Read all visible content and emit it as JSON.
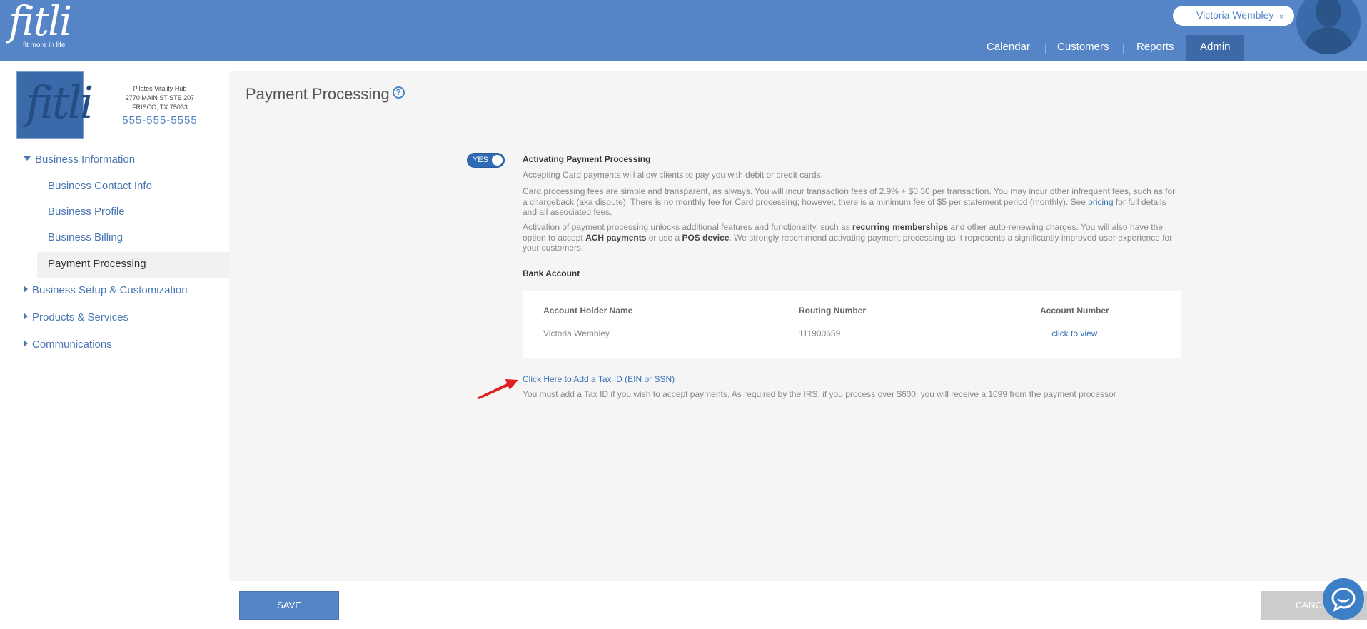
{
  "header": {
    "logo_text": "fitli",
    "logo_tagline": "fit more in life",
    "user_name": "Victoria Wembley",
    "user_chevron": "»",
    "nav": [
      {
        "label": "Calendar"
      },
      {
        "label": "Customers"
      },
      {
        "label": "Reports"
      },
      {
        "label": "Admin",
        "active": true
      }
    ]
  },
  "business": {
    "logo_text": "fitli",
    "name": "Pilates Vitality Hub",
    "address1": "2770 MAIN ST STE 207",
    "address2": "FRISCO, TX 75033",
    "phone": "555-555-5555"
  },
  "sidebar": {
    "sections": [
      {
        "label": "Business Information",
        "expanded": true
      },
      {
        "label": "Business Setup & Customization",
        "expanded": false
      },
      {
        "label": "Products & Services",
        "expanded": false
      },
      {
        "label": "Communications",
        "expanded": false
      }
    ],
    "subitems": [
      {
        "label": "Business Contact Info"
      },
      {
        "label": "Business Profile"
      },
      {
        "label": "Business Billing"
      },
      {
        "label": "Payment Processing",
        "active": true
      }
    ]
  },
  "main": {
    "title": "Payment Processing",
    "help_glyph": "?",
    "toggle_label": "YES",
    "section_title": "Activating Payment Processing",
    "para1": "Accepting Card payments will allow clients to pay you with debit or credit cards.",
    "para2_a": "Card processing fees are simple and transparent, as always. You will incur transaction fees of 2.9% + $0.30 per transaction. You may incur other infrequent fees, such as for a chargeback (aka dispute). There is no monthly fee for Card processing; however, there is a minimum fee of $5 per statement period (monthly). See ",
    "para2_link": "pricing",
    "para2_b": " for full details and all associated fees.",
    "para3_a": "Activation of payment processing unlocks additional features and functionality, such as ",
    "para3_b1": "recurring memberships",
    "para3_c": " and other auto-renewing charges. You will also have the option to accept ",
    "para3_b2": "ACH payments",
    "para3_d": " or use a ",
    "para3_b3": "POS device",
    "para3_e": ". We strongly recommend activating payment processing as it represents a significantly improved user experience for your customers.",
    "bank_title": "Bank Account",
    "bank": {
      "holder_header": "Account Holder Name",
      "holder_value": "Victoria Wembley",
      "routing_header": "Routing Number",
      "routing_value": "111900659",
      "account_header": "Account Number",
      "account_value": "click to view"
    },
    "tax_link": "Click Here to Add a Tax ID (EIN or SSN)",
    "tax_note": "You must add a Tax ID if you wish to accept payments. As required by the IRS, if you process over $600, you will receive a 1099 from the payment processor"
  },
  "footer": {
    "save_label": "SAVE",
    "cancel_label": "CANCEL"
  },
  "colors": {
    "brand": "#5585c6",
    "link": "#3a73b8",
    "toggle": "#2f6bb3",
    "annotation_arrow": "#e02020"
  }
}
